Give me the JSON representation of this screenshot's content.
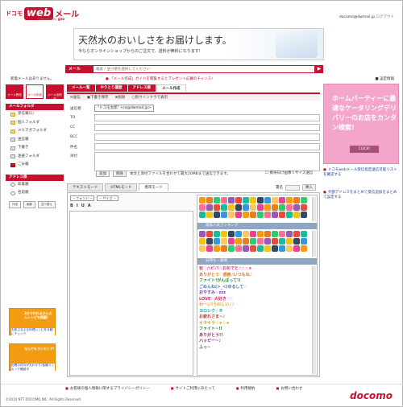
{
  "logo": {
    "prefix": "ドコモ",
    "web": "web",
    "mail": "メール",
    "powered": "powered by",
    "brand": "goo"
  },
  "user": {
    "address": "docomo@dwmail.jp",
    "logout": "ログアウト"
  },
  "banner": {
    "headline": "天然水のおいしさをお届けします。",
    "sub": "今ならオンラインショップからのご注文で、送料が無料になります!"
  },
  "search": {
    "category": "メール",
    "placeholder": "検索 / 並び順を選択してください",
    "button": "▶"
  },
  "header": {
    "new_mail": "新着メールはありません。",
    "settings": "設定情報"
  },
  "sidebar": {
    "mail_buttons": [
      "メール受信",
      "メール作成",
      "メール全削除"
    ],
    "folder_head": "メールフォルダ",
    "folders": [
      {
        "label": "受信箱(1)",
        "icon": "y"
      },
      {
        "label": "個人フォルダ",
        "icon": "y"
      },
      {
        "label": "メルマガフォルダ",
        "icon": "y"
      },
      {
        "label": "送信箱",
        "icon": "g"
      },
      {
        "label": "下書き",
        "icon": "g"
      },
      {
        "label": "迷惑フォルダ",
        "icon": "g"
      },
      {
        "label": "ごみ箱",
        "icon": "r"
      }
    ],
    "contacts_head": "アドレス帳",
    "contacts": [
      {
        "label": "新着順",
        "icon": "p"
      },
      {
        "label": "名前順",
        "icon": "p"
      }
    ],
    "controls": [
      "作成",
      "編集",
      "並べ替え"
    ],
    "ad1": {
      "title": "3分で作れるかんたんレシピを掲載!",
      "link": "お肌ぷるぷる料理レシピを手軽にチェック"
    },
    "ad2": {
      "title": "なんでもランキング!",
      "link": "世間の好みが丸わかり!各種ランキング確認中"
    }
  },
  "notice": "「メール作成」ガイドを閲覧するとプレゼント応募のチャンス!",
  "tabs": [
    "メール一覧",
    "やりとり履歴",
    "アドレス帳",
    "メール作成"
  ],
  "toolbar": [
    "送信",
    "下書き保存",
    "削除",
    "別ウインドウで表示"
  ],
  "compose": {
    "from_label": "送信者",
    "from_value": "\"ドコモ太郎\" <ra@dwmail.jp>",
    "to_label": "TO",
    "cc_label": "CC",
    "bcc_label": "BCC",
    "subject_label": "件名",
    "attach_label": "添付"
  },
  "attach": {
    "add": "追加",
    "remove": "削除",
    "note": "本文と添付ファイルを合わせて最大20MBまで送信できます。",
    "large_image": "携帯向け画像リサイズ送信"
  },
  "mode_tabs": [
    "テキストモード",
    "HTMLモード",
    "携帯モード"
  ],
  "signature": {
    "label": "署名",
    "insert": "挿入"
  },
  "editor": {
    "font": "-- フォント --",
    "size": "-- サイズ --",
    "tools": [
      "B",
      "I",
      "U",
      "A"
    ]
  },
  "picker": {
    "section_popular": "過去人気ランキング",
    "section_deco": "気持ち・感情"
  },
  "deco_lines": [
    {
      "text": "祝♡ハピバ☆おめでと♪☆☆★",
      "color": "#d63384"
    },
    {
      "text": "ありがとう♡感謝♪いつもね♪",
      "color": "#e6731c"
    },
    {
      "text": "ファイト!がんばって!!",
      "color": "#2a8a2a"
    },
    {
      "text": "ごめんね(>_<)ゆるして♡",
      "color": "#3b6fd1"
    },
    {
      "text": "おやすみ☆zzz",
      "color": "#7a3fb0"
    },
    {
      "text": "LOVE♡大好き♡♡",
      "color": "#e0245e"
    },
    {
      "text": "わーい!うれしい♪♪",
      "color": "#e6a100"
    },
    {
      "text": "ヨロシク☆ネ",
      "color": "#1c9aa8"
    },
    {
      "text": "お疲れさま~♪",
      "color": "#c0392b"
    },
    {
      "text": "キラキラ☆★☆★",
      "color": "#d4a017"
    },
    {
      "text": "ファイト~!!",
      "color": "#2f7d32"
    },
    {
      "text": "ありがとう!!",
      "color": "#c2185b"
    },
    {
      "text": "ハッピー~♪",
      "color": "#6a1b9a"
    },
    {
      "text": "ふっ~",
      "color": "#555555"
    }
  ],
  "right_ad": {
    "text": "ホームパーティーに最適なケータリングデリバリーのお店をカンタン検索!",
    "cta": "CLICK!"
  },
  "right_links": [
    "ドコモwebメール受信指定送信可能リストを確認する",
    "外部アドレスをまとめて受信追加をまとめて設定する"
  ],
  "footer": {
    "links": [
      "お客様の個人情報に関するプライバシーポリシー",
      "サイトご利用にあたって",
      "利用規約",
      "お問い合わせ"
    ],
    "copyright": "©2010 NTT DOCOMO,INC. All Rights Reserved.",
    "brand": "docomo"
  },
  "colors": {
    "accent": "#c8102e",
    "pink_ad": "#f3a6c9",
    "orange_ad": "#f39c12",
    "picker_header": "#8fa6c2"
  }
}
